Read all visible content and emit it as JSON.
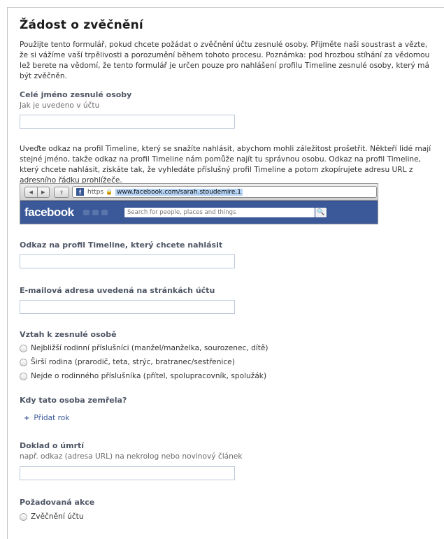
{
  "title": "Žádost o zvěčnění",
  "intro": "Použijte tento formulář, pokud chcete požádat o zvěčnění účtu zesnulé osoby. Přijměte naši soustrast a vězte, že si vážíme vaší trpělivosti a porozumění během tohoto procesu. Poznámka: pod hrozbou stíhání za vědomou lež berete na vědomí, že tento formulář je určen pouze pro nahlášení profilu Timeline zesnulé osoby, který má být zvěčněn.",
  "full_name": {
    "label": "Celé jméno zesnulé osoby",
    "hint": "Jak je uvedeno v účtu",
    "value": ""
  },
  "link_instructions": "Uveďte odkaz na profil Timeline, který se snažíte nahlásit, abychom mohli záležitost prošetřit. Někteří lidé mají stejné jméno, takže odkaz na profil Timeline nám pomůže najít tu správnou osobu. Odkaz na profil Timeline, který chcete nahlásit, získáte tak, že vyhledáte příslušný profil Timeline a potom zkopírujete adresu URL z adresního řádku prohlížeče.",
  "example_browser": {
    "back_icon": "◀",
    "forward_icon": "▶",
    "share_icon": "⇪",
    "favicon": "f",
    "scheme": "https",
    "lock_icon": "🔒",
    "url": "www.facebook.com/sarah.stoudemire.1",
    "logo": "facebook",
    "search_placeholder": "Search for people, places and things",
    "search_icon": "🔍"
  },
  "profile_link": {
    "label": "Odkaz na profil Timeline, který chcete nahlásit",
    "value": ""
  },
  "email": {
    "label": "E-mailová adresa uvedená na stránkách účtu",
    "value": ""
  },
  "relationship": {
    "label": "Vztah k zesnulé osobě",
    "options": [
      "Nejbližší rodinní příslušníci (manžel/manželka, sourozenec, dítě)",
      "Širší rodina (prarodič, teta, strýc, bratranec/sestřenice)",
      "Nejde o rodinného příslušníka (přítel, spolupracovník, spolužák)"
    ]
  },
  "death_date": {
    "label": "Kdy tato osoba zemřela?",
    "add_year": "Přidat rok",
    "plus": "+"
  },
  "proof": {
    "label": "Doklad o úmrtí",
    "hint": "např. odkaz (adresa URL) na nekrolog nebo novinový článek",
    "value": ""
  },
  "action": {
    "label": "Požadovaná akce",
    "options": [
      "Zvěčnění účtu"
    ]
  }
}
